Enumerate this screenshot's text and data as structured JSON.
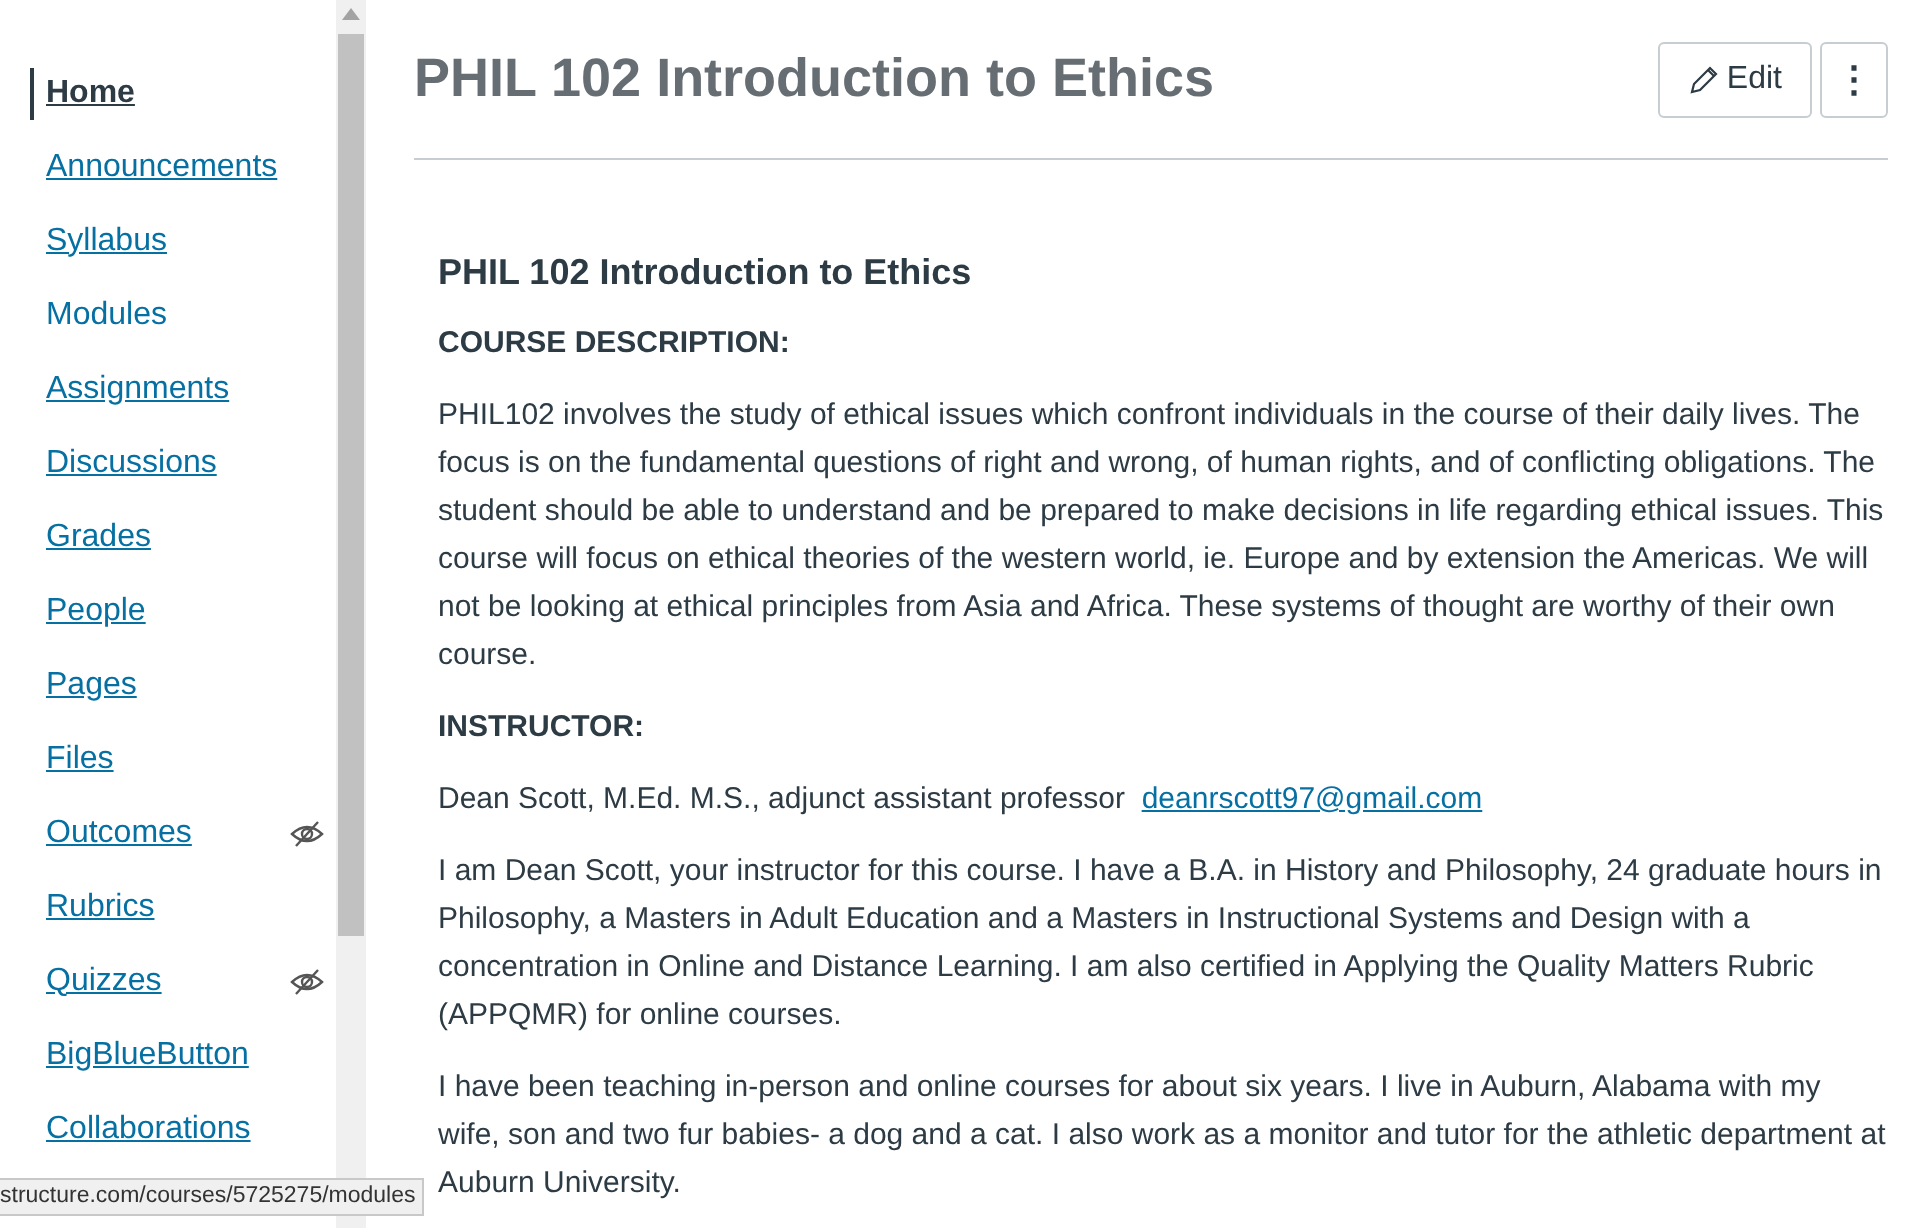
{
  "sidebar": {
    "items": [
      {
        "label": "Home",
        "selected": true,
        "hovered": false,
        "hidden": false
      },
      {
        "label": "Announcements",
        "selected": false,
        "hovered": false,
        "hidden": false
      },
      {
        "label": "Syllabus",
        "selected": false,
        "hovered": false,
        "hidden": false
      },
      {
        "label": "Modules",
        "selected": false,
        "hovered": true,
        "hidden": false
      },
      {
        "label": "Assignments",
        "selected": false,
        "hovered": false,
        "hidden": false
      },
      {
        "label": "Discussions",
        "selected": false,
        "hovered": false,
        "hidden": false
      },
      {
        "label": "Grades",
        "selected": false,
        "hovered": false,
        "hidden": false
      },
      {
        "label": "People",
        "selected": false,
        "hovered": false,
        "hidden": false
      },
      {
        "label": "Pages",
        "selected": false,
        "hovered": false,
        "hidden": false
      },
      {
        "label": "Files",
        "selected": false,
        "hovered": false,
        "hidden": false
      },
      {
        "label": "Outcomes",
        "selected": false,
        "hovered": false,
        "hidden": true
      },
      {
        "label": "Rubrics",
        "selected": false,
        "hovered": false,
        "hidden": false
      },
      {
        "label": "Quizzes",
        "selected": false,
        "hovered": false,
        "hidden": true
      },
      {
        "label": "BigBlueButton",
        "selected": false,
        "hovered": false,
        "hidden": false
      },
      {
        "label": "Collaborations",
        "selected": false,
        "hovered": false,
        "hidden": false
      }
    ]
  },
  "header": {
    "title": "PHIL 102 Introduction to Ethics",
    "edit_button": "Edit",
    "more_button": "⋮"
  },
  "content": [
    {
      "kind": "heading",
      "text": "PHIL 102 Introduction to Ethics"
    },
    {
      "kind": "label",
      "text": "COURSE DESCRIPTION:"
    },
    {
      "kind": "paragraph",
      "text": "PHIL102 involves the study of ethical issues which confront individuals in the course of their daily lives. The focus is on the fundamental questions of right and wrong, of human rights, and of conflicting obligations. The student should be able to understand and be prepared to make decisions in life regarding ethical issues. This course will focus on ethical theories of the western world, ie. Europe and by extension the Americas. We will not be looking at ethical principles from Asia and Africa. These systems of thought are worthy of their own course."
    },
    {
      "kind": "label",
      "text": "INSTRUCTOR:"
    },
    {
      "kind": "contact",
      "text": "Dean Scott, M.Ed. M.S., adjunct assistant professor",
      "link": "deanrscott97@gmail.com"
    },
    {
      "kind": "paragraph",
      "text": "I am Dean Scott, your instructor for this course. I have a B.A. in History and Philosophy, 24 graduate hours in Philosophy, a Masters in Adult Education and a Masters in Instructional Systems and Design with a concentration in Online and Distance Learning. I am also certified in Applying the Quality Matters Rubric (APPQMR) for online courses."
    },
    {
      "kind": "paragraph",
      "text": "I have been teaching in-person and online courses for about six years. I live in Auburn, Alabama with my wife, son and two fur babies- a dog and a cat. I also work as a monitor and tutor for the athletic department at Auburn University."
    }
  ],
  "status_bar": {
    "url": "structure.com/courses/5725275/modules"
  }
}
